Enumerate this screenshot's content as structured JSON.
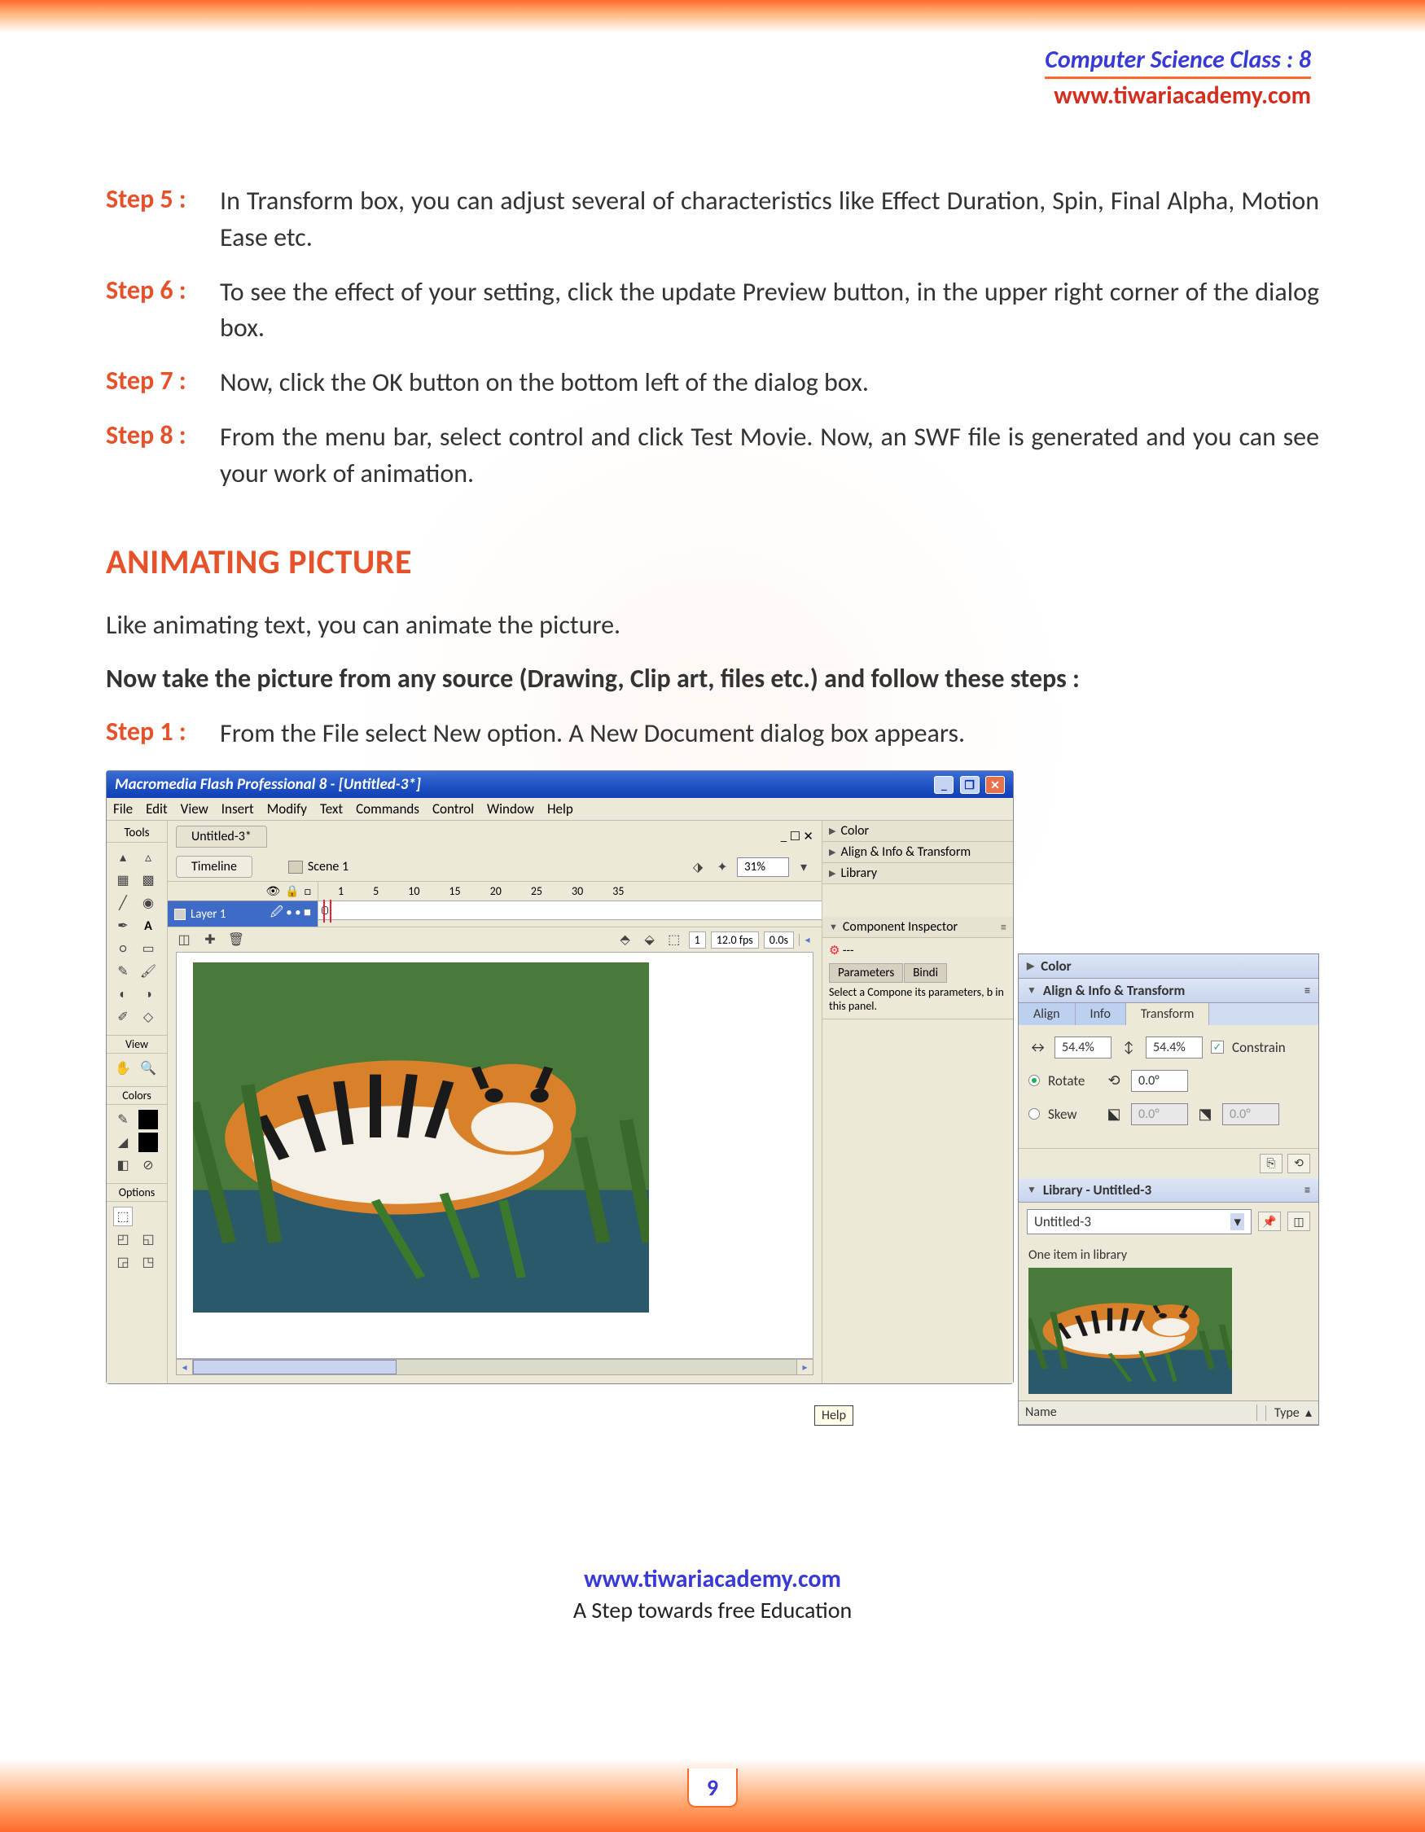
{
  "header": {
    "class": "Computer Science Class : 8",
    "url": "www.tiwariacademy.com"
  },
  "steps_a": [
    {
      "label": "Step 5 :",
      "text": "In Transform box, you can adjust several of characteristics like Effect Duration, Spin, Final Alpha, Motion Ease etc."
    },
    {
      "label": "Step 6 :",
      "text": "To see the effect of your setting, click the update Preview button, in the upper right corner of the dialog box."
    },
    {
      "label": "Step 7 :",
      "text": "Now, click the OK button on the bottom left of the dialog box."
    },
    {
      "label": "Step 8 :",
      "text": "From the menu bar, select control and click Test Movie. Now, an SWF file is generated and you can see your work of animation."
    }
  ],
  "section_title": "ANIMATING PICTURE",
  "lead1": "Like animating text, you can animate the picture.",
  "lead2": "Now take the picture from any source (Drawing, Clip art, files etc.) and follow these steps :",
  "step1": {
    "label": "Step 1 :",
    "text": "From the File select New option. A New Document dialog box appears."
  },
  "flash": {
    "title": "Macromedia Flash Professional 8 - [Untitled-3*]",
    "menus": [
      "File",
      "Edit",
      "View",
      "Insert",
      "Modify",
      "Text",
      "Commands",
      "Control",
      "Window",
      "Help"
    ],
    "doc_tab": "Untitled-3*",
    "timeline_btn": "Timeline",
    "scene": "Scene 1",
    "zoom": "31%",
    "layer": "Layer 1",
    "ruler": [
      "1",
      "5",
      "10",
      "15",
      "20",
      "25",
      "30",
      "35"
    ],
    "frame_info": {
      "frame": "1",
      "fps": "12.0 fps",
      "time": "0.0s"
    },
    "tools_label": "Tools",
    "view_label": "View",
    "colors_label": "Colors",
    "options_label": "Options",
    "side": {
      "color": "Color",
      "ait": "Align & Info & Transform",
      "library": "Library",
      "comp": "Component Inspector",
      "tabs": [
        "Parameters",
        "Bindi"
      ],
      "help": "Select a Compone its parameters, b in this panel."
    }
  },
  "float": {
    "color": "Color",
    "ait": "Align & Info & Transform",
    "tabs": [
      "Align",
      "Info",
      "Transform"
    ],
    "scale_a": "54.4%",
    "scale_b": "54.4%",
    "constrain": "Constrain",
    "rotate": "Rotate",
    "rot_val": "0.0°",
    "skew": "Skew",
    "skew_a": "0.0°",
    "skew_b": "0.0°",
    "lib_title": "Library - Untitled-3",
    "lib_select": "Untitled-3",
    "lib_count": "One item in library",
    "name": "Name",
    "type": "Type"
  },
  "help_tag": "Help",
  "footer": {
    "url": "www.tiwariacademy.com",
    "tagline": "A Step towards free Education"
  },
  "page_num": "9"
}
